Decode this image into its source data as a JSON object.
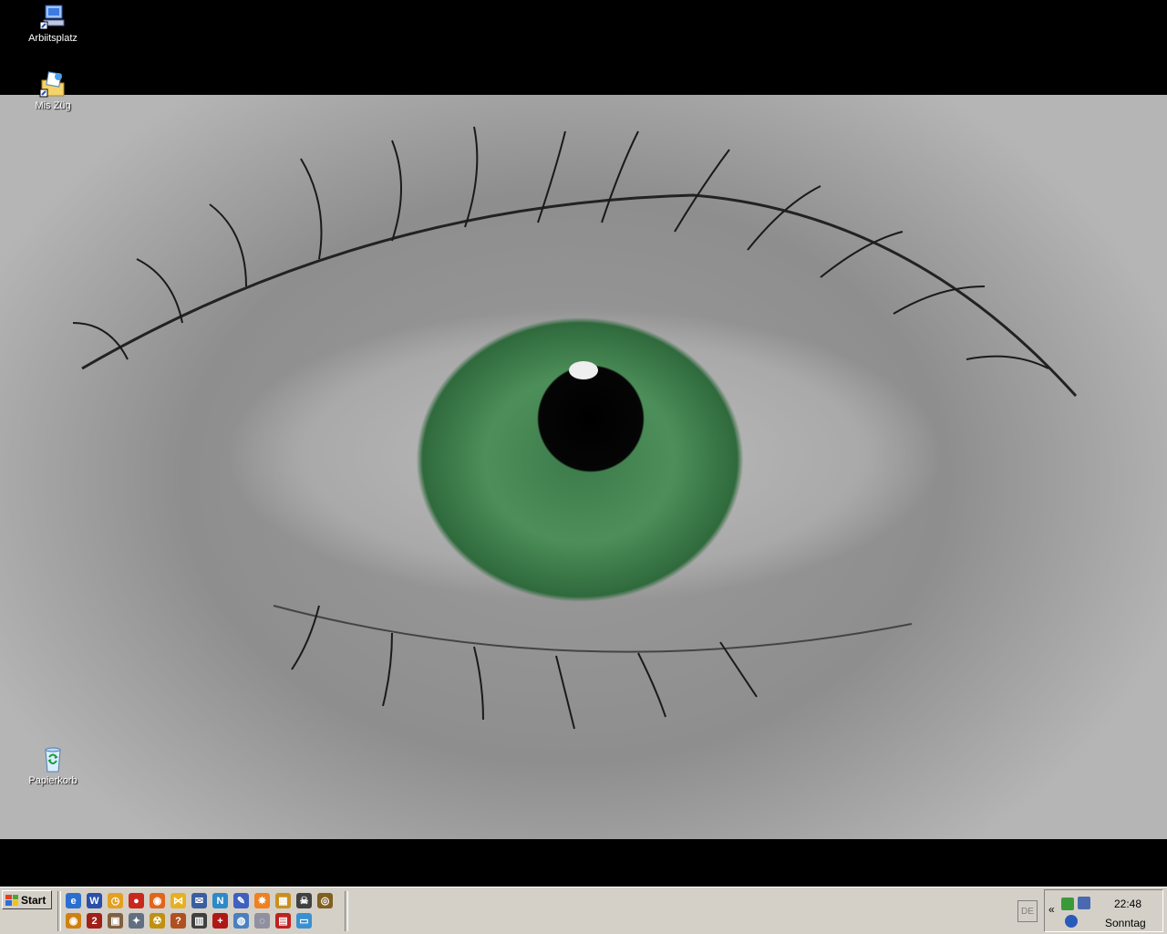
{
  "desktop": {
    "icons": [
      {
        "label": "Arbiitsplatz",
        "icon": "my-computer-icon"
      },
      {
        "label": "Mis Züg",
        "icon": "my-documents-icon"
      },
      {
        "label": "Papierkorb",
        "icon": "recycle-bin-icon"
      }
    ],
    "wallpaper": "green-eye-closeup"
  },
  "taskbar": {
    "start_label": "Start",
    "quick_launch": [
      {
        "icon": "internet-explorer-icon",
        "glyph": "e",
        "color": "#2a6fd0"
      },
      {
        "icon": "word-icon",
        "glyph": "W",
        "color": "#2b4fa8"
      },
      {
        "icon": "clock-app-icon",
        "glyph": "◷",
        "color": "#e4a020"
      },
      {
        "icon": "realplayer-icon",
        "glyph": "●",
        "color": "#c8281e"
      },
      {
        "icon": "firefox-icon",
        "glyph": "◉",
        "color": "#e0661e"
      },
      {
        "icon": "butterfly-icon",
        "glyph": "⋈",
        "color": "#e8b020"
      },
      {
        "icon": "thunderbird-icon",
        "glyph": "✉",
        "color": "#3a5fa0"
      },
      {
        "icon": "mozilla-icon",
        "glyph": "N",
        "color": "#2c8ac8"
      },
      {
        "icon": "editor-icon",
        "glyph": "✎",
        "color": "#4060c0"
      },
      {
        "icon": "star-app-icon",
        "glyph": "✸",
        "color": "#f08020"
      },
      {
        "icon": "winamp-icon",
        "glyph": "▦",
        "color": "#c89020"
      },
      {
        "icon": "skull-icon",
        "glyph": "☠",
        "color": "#404040"
      },
      {
        "icon": "media-eye-icon",
        "glyph": "◎",
        "color": "#806020"
      },
      {
        "icon": "speaker-icon",
        "glyph": "◉",
        "color": "#d08010"
      },
      {
        "icon": "number-two-icon",
        "glyph": "2",
        "color": "#a02018"
      },
      {
        "icon": "gamepad-icon",
        "glyph": "▣",
        "color": "#806040"
      },
      {
        "icon": "satellite-icon",
        "glyph": "✦",
        "color": "#607080"
      },
      {
        "icon": "radiation-icon",
        "glyph": "☢",
        "color": "#c09010"
      },
      {
        "icon": "question-app-icon",
        "glyph": "?",
        "color": "#b05020"
      },
      {
        "icon": "mixer-icon",
        "glyph": "▥",
        "color": "#404040"
      },
      {
        "icon": "cross-icon",
        "glyph": "+",
        "color": "#b01818"
      },
      {
        "icon": "globe-icon",
        "glyph": "◍",
        "color": "#4a80c0"
      },
      {
        "icon": "cd-icon",
        "glyph": "◌",
        "color": "#9090a0"
      },
      {
        "icon": "book-icon",
        "glyph": "▤",
        "color": "#c02020"
      },
      {
        "icon": "document-icon",
        "glyph": "▭",
        "color": "#3a90d0"
      }
    ],
    "language": "DE",
    "tray_toggle": "«",
    "clock": {
      "time": "22:48",
      "day": "Sonntag"
    }
  }
}
